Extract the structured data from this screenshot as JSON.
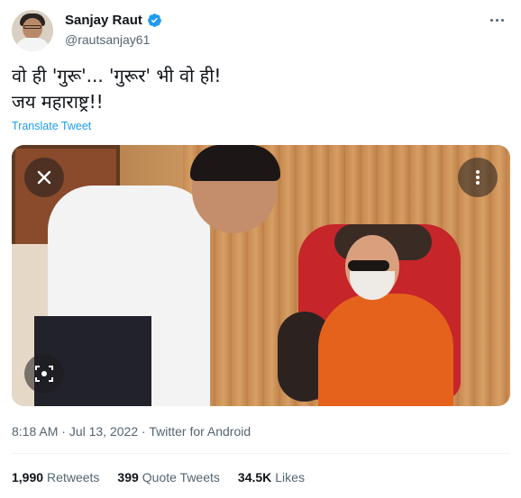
{
  "author": {
    "display_name": "Sanjay Raut",
    "handle": "@rautsanjay61",
    "verified_icon": "verified-badge-icon"
  },
  "tweet": {
    "lines": [
      "वो ही 'गुरू'... 'गुरूर' भी वो ही!",
      "जय महाराष्ट्र!!"
    ],
    "translate_label": "Translate Tweet"
  },
  "media": {
    "close_icon": "close-icon",
    "more_icon": "more-vertical-icon",
    "lens_icon": "visual-search-icon"
  },
  "meta": {
    "time": "8:18 AM",
    "separator1": " · ",
    "date": "Jul 13, 2022",
    "separator2": " · ",
    "source": "Twitter for Android"
  },
  "stats": {
    "retweets_count": "1,990",
    "retweets_label": "Retweets",
    "quotes_count": "399",
    "quotes_label": "Quote Tweets",
    "likes_count": "34.5K",
    "likes_label": "Likes"
  },
  "colors": {
    "link": "#1d9bf0",
    "secondary_text": "#536471",
    "primary_text": "#0f1419"
  }
}
